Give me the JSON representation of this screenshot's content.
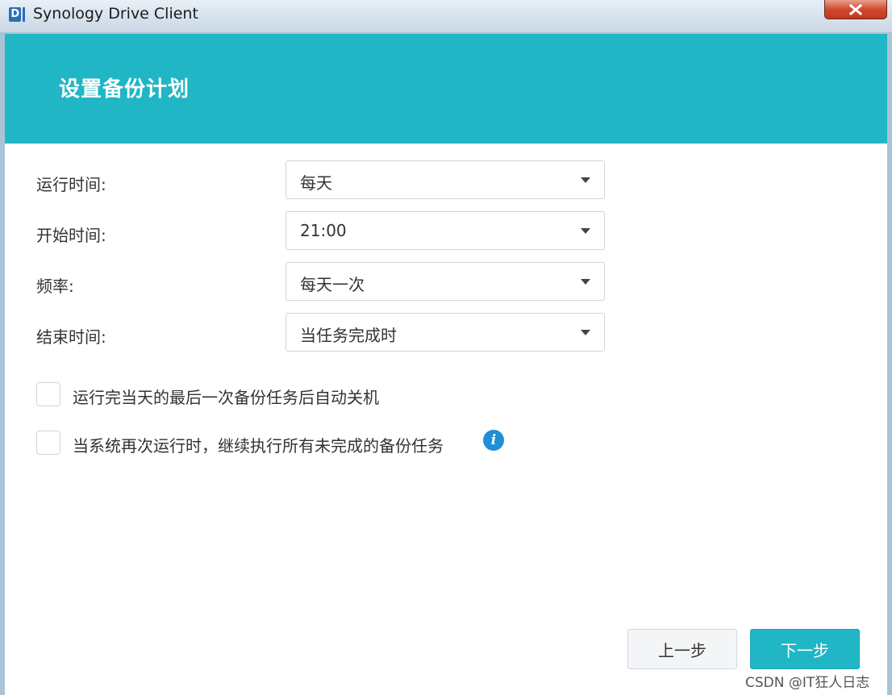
{
  "window": {
    "title": "Synology Drive Client",
    "icon": "synology-drive-logo",
    "close_icon": "close-x-icon"
  },
  "dialog": {
    "header_title": "设置备份计划",
    "header_color": "#20b6c5",
    "fields": [
      {
        "label": "运行时间:",
        "value": "每天"
      },
      {
        "label": "开始时间:",
        "value": "21:00"
      },
      {
        "label": "频率:",
        "value": "每天一次"
      },
      {
        "label": "结束时间:",
        "value": "当任务完成时"
      }
    ],
    "options": [
      {
        "label": "运行完当天的最后一次备份任务后自动关机",
        "checked": false
      },
      {
        "label": "当系统再次运行时，继续执行所有未完成的备份任务",
        "checked": false
      }
    ],
    "info_icon": "info-icon",
    "buttons": {
      "prev": "上一步",
      "next": "下一步"
    }
  },
  "watermark": "CSDN @IT狂人日志"
}
